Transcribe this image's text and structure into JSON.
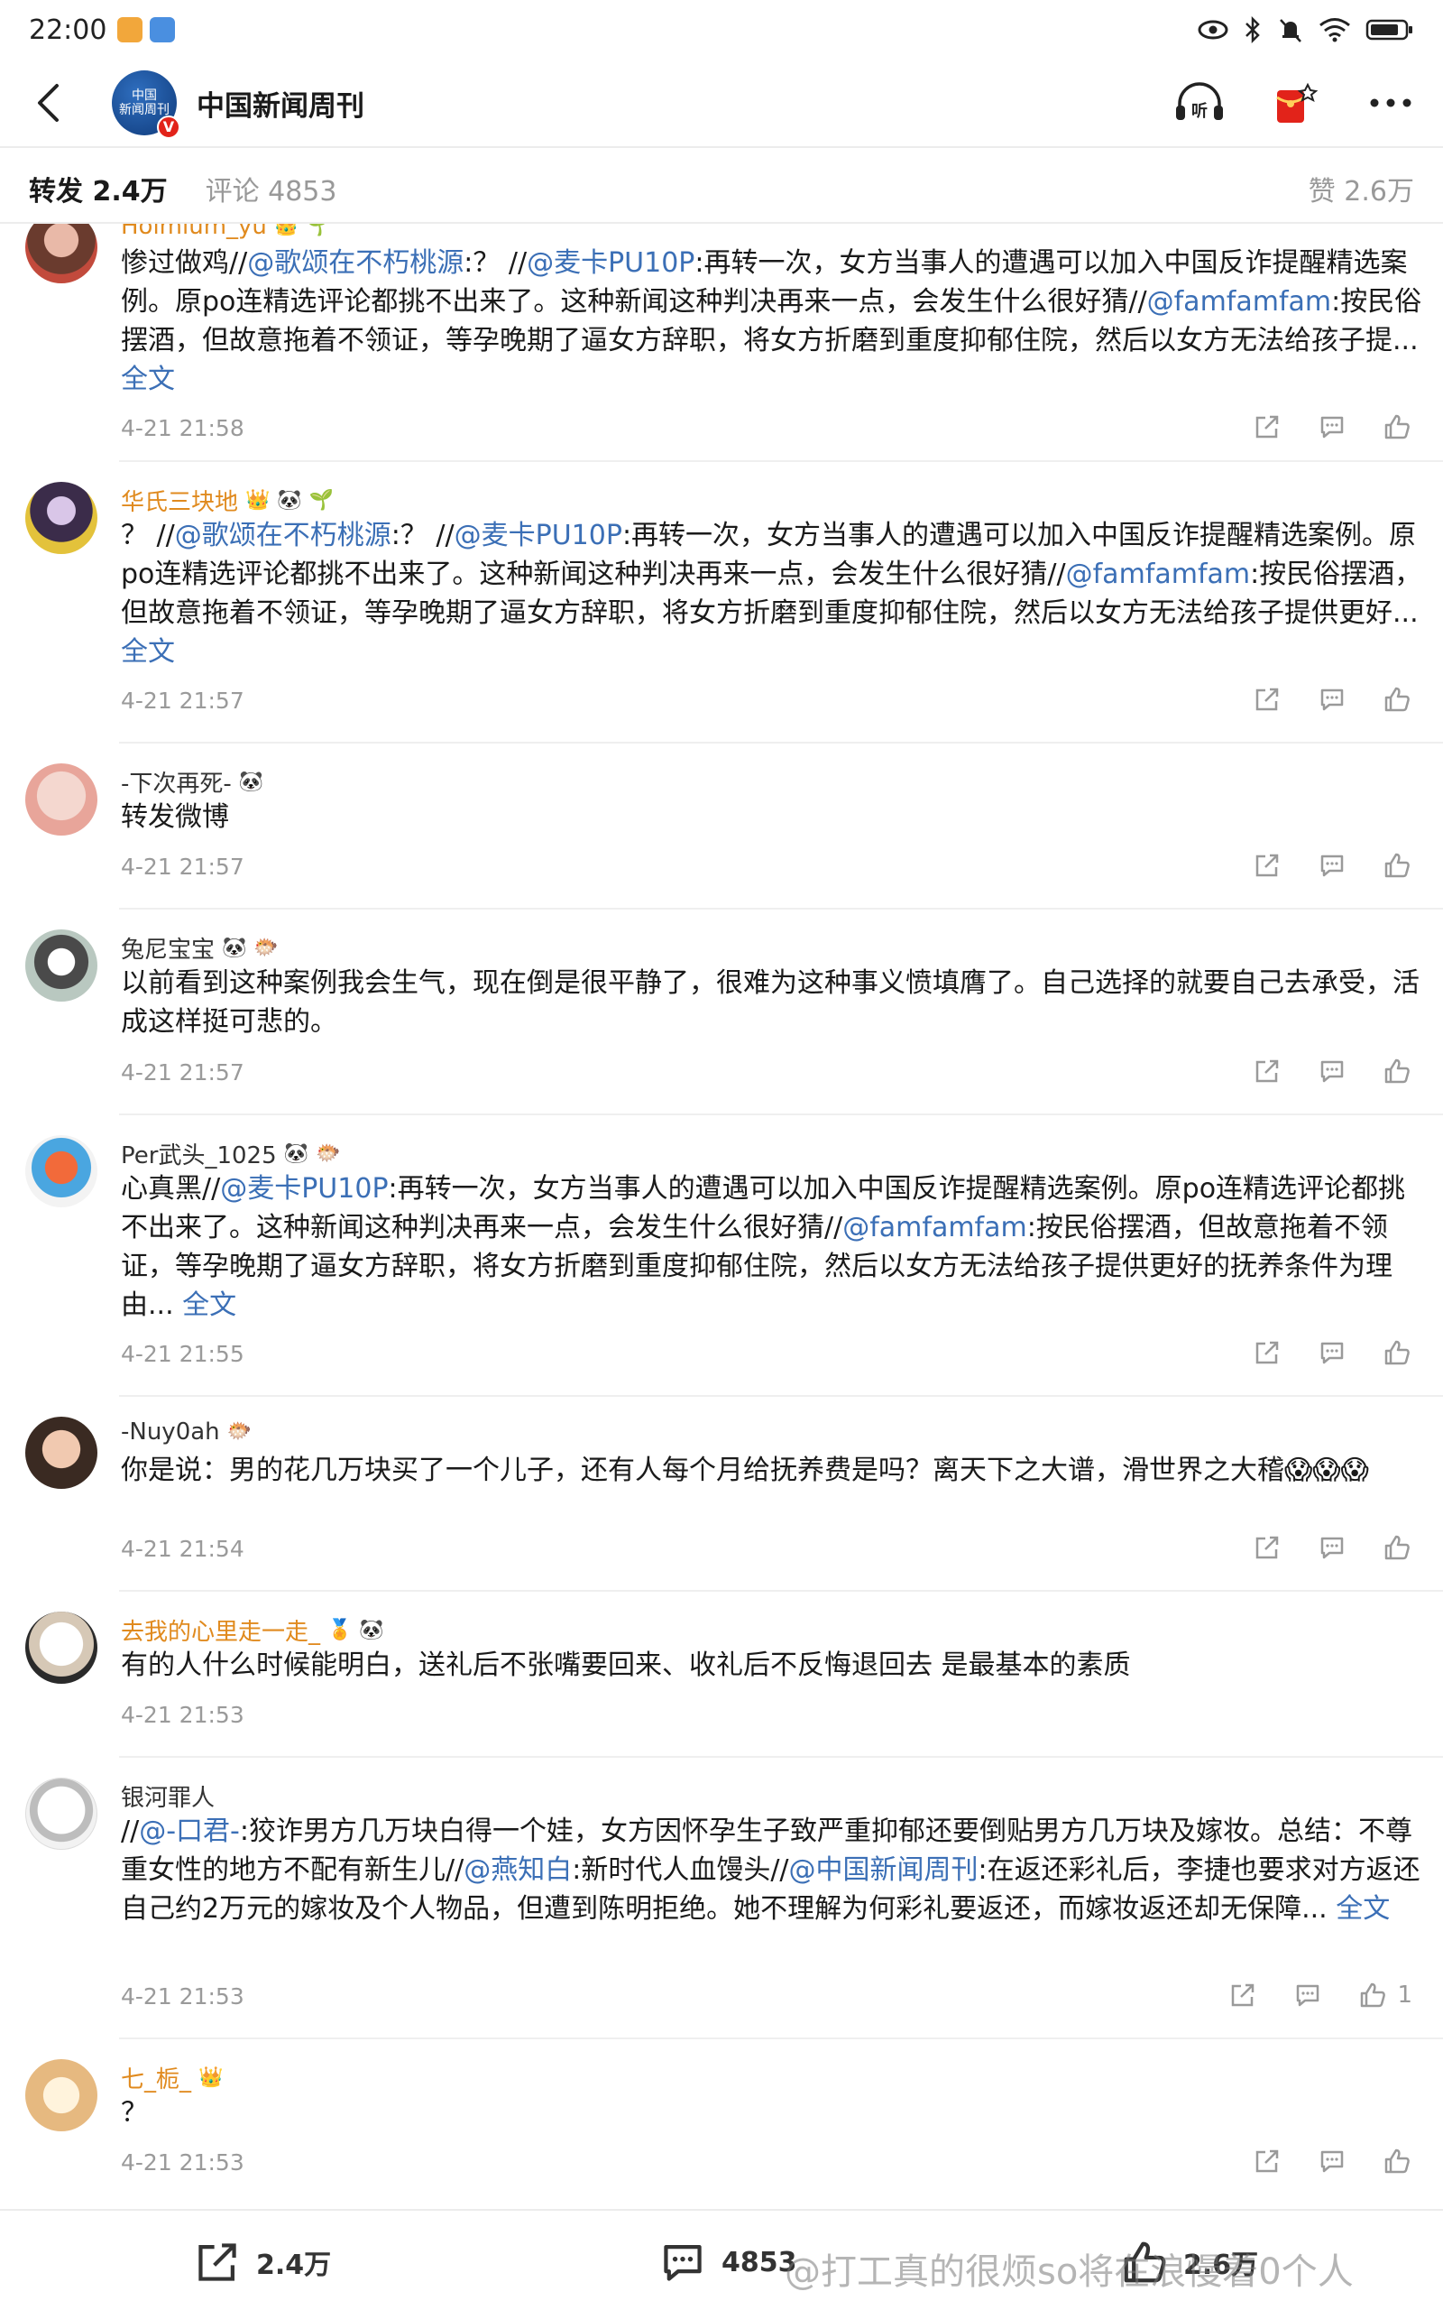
{
  "status_bar": {
    "time": "22:00"
  },
  "header": {
    "account_name": "中国新闻周刊",
    "avatar_text": "中国\n新闻周刊",
    "verified_badge": "V"
  },
  "tabs": {
    "repost": "转发 2.4万",
    "comments": "评论 4853",
    "likes": "赞 2.6万"
  },
  "comments": [
    {
      "username": "Holmium_yu",
      "text_parts": [
        "惨过做鸡//",
        "@歌颂在不朽桃源",
        ":？ //",
        "@麦卡PU10P",
        ":再转一次，女方当事人的遭遇可以加入中国反诈提醒精选案例。原po连精选评论都挑不出来了。这种新闻这种判决再来一点，会发生什么很好猜//",
        "@famfamfam",
        ":按民俗摆酒，但故意拖着不领证，等孕晚期了逼女方辞职，将女方折磨到重度抑郁住院，然后以女方无法给孩子提... ",
        "全文"
      ],
      "time": "4-21 21:58"
    },
    {
      "username": "华氏三块地",
      "text_parts": [
        "？ //",
        "@歌颂在不朽桃源",
        ":？ //",
        "@麦卡PU10P",
        ":再转一次，女方当事人的遭遇可以加入中国反诈提醒精选案例。原po连精选评论都挑不出来了。这种新闻这种判决再来一点，会发生什么很好猜//",
        "@famfamfam",
        ":按民俗摆酒，但故意拖着不领证，等孕晚期了逼女方辞职，将女方折磨到重度抑郁住院，然后以女方无法给孩子提供更好... ",
        "全文"
      ],
      "time": "4-21 21:57"
    },
    {
      "username": "-下次再死-",
      "text_parts": [
        "转发微博"
      ],
      "time": "4-21 21:57"
    },
    {
      "username": "兔尼宝宝",
      "text_parts": [
        "以前看到这种案例我会生气，现在倒是很平静了，很难为这种事义愤填膺了。自己选择的就要自己去承受，活成这样挺可悲的。"
      ],
      "time": "4-21 21:57"
    },
    {
      "username": "Per武头_1025",
      "text_parts": [
        "心真黑//",
        "@麦卡PU10P",
        ":再转一次，女方当事人的遭遇可以加入中国反诈提醒精选案例。原po连精选评论都挑不出来了。这种新闻这种判决再来一点，会发生什么很好猜//",
        "@famfamfam",
        ":按民俗摆酒，但故意拖着不领证，等孕晚期了逼女方辞职，将女方折磨到重度抑郁住院，然后以女方无法给孩子提供更好的抚养条件为理由... ",
        "全文"
      ],
      "time": "4-21 21:55"
    },
    {
      "username": "-Nuy0ah",
      "text_parts": [
        "你是说：男的花几万块买了一个儿子，还有人每个月给抚养费是吗？离天下之大谱，滑世界之大稽😱😱😱"
      ],
      "time": "4-21 21:54"
    },
    {
      "username": "去我的心里走一走_",
      "text_parts": [
        "有的人什么时候能明白，送礼后不张嘴要回来、收礼后不反悔退回去 是最基本的素质"
      ],
      "time": "4-21 21:53"
    },
    {
      "username": "银河罪人",
      "text_parts": [
        "//",
        "@-口君-",
        ":狡诈男方几万块白得一个娃，女方因怀孕生子致严重抑郁还要倒贴男方几万块及嫁妆。总结：不尊重女性的地方不配有新生儿//",
        "@燕知白",
        ":新时代人血馒头//",
        "@中国新闻周刊",
        ":在返还彩礼后，李捷也要求对方返还自己约2万元的嫁妆及个人物品，但遭到陈明拒绝。她不理解为何彩礼要返还，而嫁妆返还却无保障... ",
        "全文"
      ],
      "time": "4-21 21:53",
      "like_count": "1"
    },
    {
      "username": "七_栀_",
      "text_parts": [
        "？"
      ],
      "time": "4-21 21:53"
    }
  ],
  "bottom_bar": {
    "repost_count": "2.4万",
    "comment_count": "4853",
    "like_count": "2.6万"
  },
  "watermark": "@打工真的很烦so将在浪慢着0个人"
}
